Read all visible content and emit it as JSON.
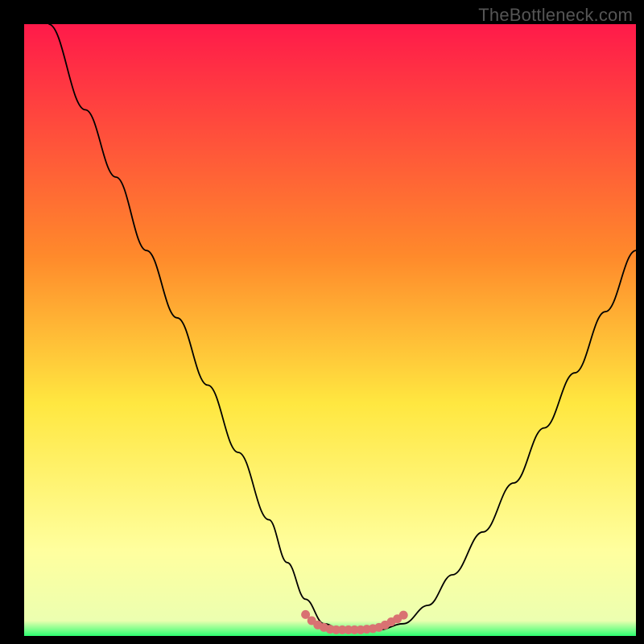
{
  "attribution": "TheBottleneck.com",
  "colors": {
    "gradient_top": "#ff1a4a",
    "gradient_mid1": "#ff8a2b",
    "gradient_mid2": "#ffe740",
    "gradient_low": "#ffff9e",
    "gradient_bottom": "#2cff70",
    "curve_stroke": "#000000",
    "marker": "#d97272",
    "background": "#000000"
  },
  "chart_data": {
    "type": "line",
    "title": "",
    "xlabel": "",
    "ylabel": "",
    "xlim": [
      0,
      100
    ],
    "ylim": [
      0,
      100
    ],
    "series": [
      {
        "name": "bottleneck-curve",
        "x": [
          4,
          10,
          15,
          20,
          25,
          30,
          35,
          40,
          43,
          46,
          49,
          52,
          55,
          58,
          62,
          66,
          70,
          75,
          80,
          85,
          90,
          95,
          100
        ],
        "y": [
          100,
          86,
          75,
          63,
          52,
          41,
          30,
          19,
          12,
          6,
          2,
          1,
          1,
          1,
          2,
          5,
          10,
          17,
          25,
          34,
          43,
          53,
          63
        ]
      },
      {
        "name": "optimal-range-markers",
        "x": [
          46,
          47,
          48,
          49,
          50,
          51,
          52,
          53,
          54,
          55,
          56,
          57,
          58,
          59,
          60,
          61,
          62
        ],
        "y": [
          3.5,
          2.5,
          1.8,
          1.4,
          1.1,
          1.0,
          1.0,
          1.0,
          1.0,
          1.0,
          1.1,
          1.2,
          1.4,
          1.8,
          2.3,
          2.8,
          3.4
        ]
      }
    ],
    "annotations": []
  }
}
